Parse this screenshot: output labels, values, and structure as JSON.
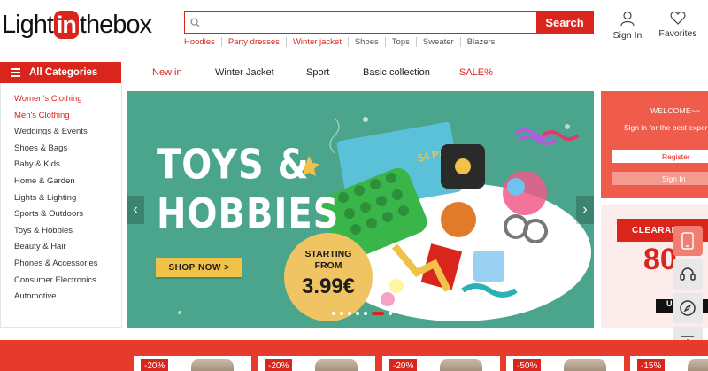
{
  "brand": {
    "pre": "Light",
    "mid": "in",
    "post": "thebox"
  },
  "search": {
    "placeholder": "",
    "button": "Search"
  },
  "hot_searches": [
    {
      "label": "Hoodies",
      "style": "red"
    },
    {
      "label": "Party dresses",
      "style": "red"
    },
    {
      "label": "Winter jacket",
      "style": "red"
    },
    {
      "label": "Shoes",
      "style": "gray"
    },
    {
      "label": "Tops",
      "style": "gray"
    },
    {
      "label": "Sweater",
      "style": "gray"
    },
    {
      "label": "Blazers",
      "style": "gray"
    }
  ],
  "header": {
    "signin_label": "Sign In",
    "favorites_label": "Favorites"
  },
  "nav": {
    "all_categories": "All Categories",
    "links": [
      "New in",
      "Winter Jacket",
      "Sport",
      "Basic collection",
      "SALE%"
    ]
  },
  "sidebar": {
    "items": [
      "Women's Clothing",
      "Men's Clothing",
      "Weddings & Events",
      "Shoes & Bags",
      "Baby & Kids",
      "Home & Garden",
      "Lights & Lighting",
      "Sports & Outdoors",
      "Toys & Hobbies",
      "Beauty & Hair",
      "Phones & Accessories",
      "Consumer Electronics",
      "Automotive"
    ]
  },
  "banner": {
    "title_line1": "TOYS &",
    "title_line2": "HOBBIES",
    "cta": "SHOP NOW >",
    "price_label_1": "STARTING",
    "price_label_2": "FROM",
    "price_value": "3.99€",
    "toy_box_label": "54 Pack",
    "slide_count": 7,
    "active_slide": 5
  },
  "welcome": {
    "title": "WELCOME~~",
    "subtitle": "Sign in for the best experience",
    "register": "Register",
    "signin": "Sign In"
  },
  "promo": {
    "head": "CLEARANCE",
    "big": "80",
    "bottom": "UP"
  },
  "deals": [
    "-20%",
    "-20%",
    "-20%",
    "-50%",
    "-15%"
  ],
  "colors": {
    "brand_red": "#d9251c",
    "banner_green": "#4aa58c",
    "gold": "#f1c24a"
  }
}
